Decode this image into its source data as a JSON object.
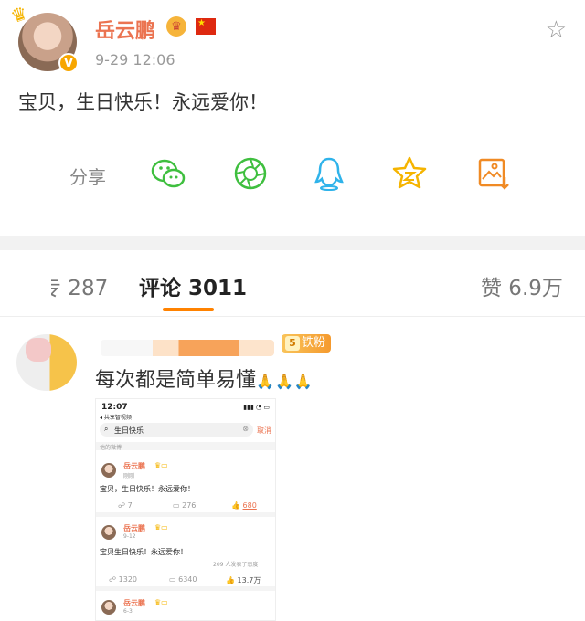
{
  "post": {
    "username": "岳云鹏",
    "timestamp": "9-29 12:06",
    "text": "宝贝，生日快乐！永远爱你！",
    "verified_badge": "V",
    "accent_color": "#eb7350"
  },
  "share": {
    "label": "分享",
    "targets": [
      "wechat-icon",
      "moments-icon",
      "qq-icon",
      "qzone-icon",
      "save-image-icon"
    ]
  },
  "tabs": [
    {
      "label": "专 287"
    },
    {
      "label": "评论 3011",
      "active": true
    },
    {
      "label": "赞 6.9万"
    }
  ],
  "comment": {
    "badge_level": "5",
    "badge_label": "铁粉",
    "text": "每次都是简单易懂",
    "emoji": "🙏🙏🙏"
  },
  "embedded_screenshot": {
    "time": "12:07",
    "back_label": "◂ 共享智视频",
    "search_value": "生日快乐",
    "cancel_label": "取消",
    "section_label": "他的微博",
    "posts": [
      {
        "username": "岳云鹏",
        "timestamp": "刚刚",
        "text": "宝贝，生日快乐！永远爱你！",
        "reposts": "7",
        "comments": "276",
        "likes": "680"
      },
      {
        "username": "岳云鹏",
        "timestamp": "9-12",
        "text": "宝贝生日快乐！永远爱你！",
        "note": "209 人发表了态度",
        "reposts": "1320",
        "comments": "6340",
        "likes": "13.7万"
      },
      {
        "username": "岳云鹏",
        "timestamp": "6-3"
      }
    ]
  }
}
